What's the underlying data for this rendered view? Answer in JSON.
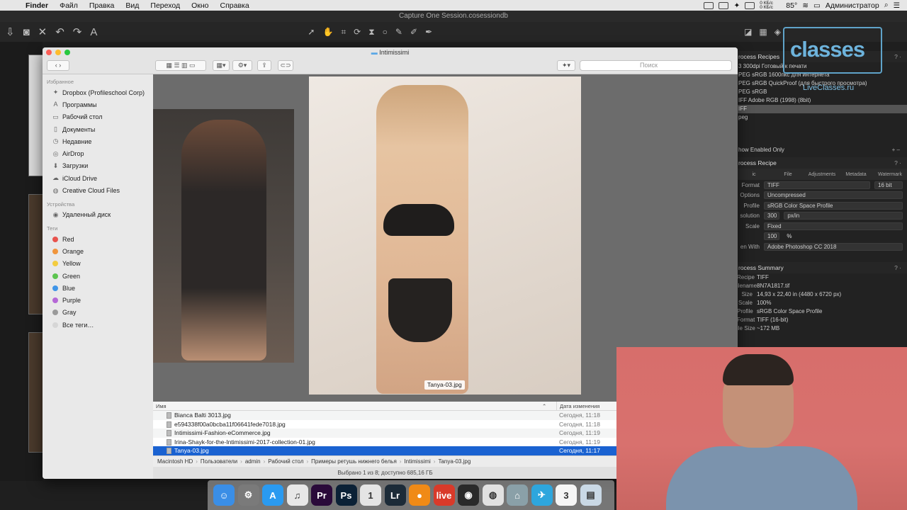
{
  "menubar": {
    "app_name": "Finder",
    "items": [
      "Файл",
      "Правка",
      "Вид",
      "Переход",
      "Окно",
      "Справка"
    ],
    "battery": "85°",
    "net_up": "0 КБ/с",
    "net_down": "0 КБ/с",
    "user": "Администратор"
  },
  "c1": {
    "window_title": "Capture One Session.cosessiondb",
    "recipes_header": "rocess Recipes",
    "recipes": [
      "3 300dpi Готовый к печати",
      "PEG sRGB 1600пкс для интернета",
      "PEG sRGB QuickProof (для быстрого просмотра)",
      "PEG sRGB",
      "IFF Adobe RGB (1998) (8bit)",
      "IFF",
      "peg"
    ],
    "show_enabled": "how Enabled Only",
    "recipe_header": "rocess Recipe",
    "tabs": [
      "ic",
      "File",
      "Adjustments",
      "Metadata",
      "Watermark"
    ],
    "format_label": "Format",
    "format_value": "TIFF",
    "bit_value": "16 bit",
    "options_label": "Options",
    "options_value": "Uncompressed",
    "profile_label": "Profile",
    "profile_value": "sRGB Color Space Profile",
    "resolution_label": "solution",
    "resolution_value": "300",
    "resolution_unit": "px/in",
    "scale_label": "Scale",
    "scale_value": "Fixed",
    "scale_pct": "100",
    "pct_sign": "%",
    "open_with_label": "en With",
    "open_with_value": "Adobe Photoshop CC 2018",
    "summary_header": "rocess Summary",
    "summary": [
      {
        "label": "Recipe",
        "value": "TIFF"
      },
      {
        "label": "ilename",
        "value": "8N7A1817.tif"
      },
      {
        "label": "Size",
        "value": "14,93 x 22,40 in (4480 x 6720 px)"
      },
      {
        "label": "Scale",
        "value": "100%"
      },
      {
        "label": "Profile",
        "value": "sRGB Color Space Profile"
      },
      {
        "label": "Format",
        "value": "TIFF (16-bit)"
      },
      {
        "label": "ile Size",
        "value": "~172 MB"
      }
    ]
  },
  "logo": {
    "big": "classes",
    "small": "LiveClasses.ru"
  },
  "finder": {
    "title": "Intimissimi",
    "search_placeholder": "Поиск",
    "favorites_header": "Избранное",
    "favorites": [
      {
        "icon": "dropbox-icon",
        "label": "Dropbox (Profileschool Corp)"
      },
      {
        "icon": "applications-icon",
        "label": "Программы"
      },
      {
        "icon": "desktop-icon",
        "label": "Рабочий стол"
      },
      {
        "icon": "documents-icon",
        "label": "Документы"
      },
      {
        "icon": "recents-icon",
        "label": "Недавние"
      },
      {
        "icon": "airdrop-icon",
        "label": "AirDrop"
      },
      {
        "icon": "downloads-icon",
        "label": "Загрузки"
      },
      {
        "icon": "icloud-icon",
        "label": "iCloud Drive"
      },
      {
        "icon": "creative-cloud-icon",
        "label": "Creative Cloud Files"
      }
    ],
    "devices_header": "Устройства",
    "devices": [
      {
        "icon": "remote-disk-icon",
        "label": "Удаленный диск"
      }
    ],
    "tags_header": "Теги",
    "tags": [
      {
        "label": "Red",
        "color": "#e8534d"
      },
      {
        "label": "Orange",
        "color": "#f0953c"
      },
      {
        "label": "Yellow",
        "color": "#f3cc3f"
      },
      {
        "label": "Green",
        "color": "#5cc44f"
      },
      {
        "label": "Blue",
        "color": "#3f95e8"
      },
      {
        "label": "Purple",
        "color": "#b568d6"
      },
      {
        "label": "Gray",
        "color": "#9a9a9a"
      },
      {
        "label": "Все теги…",
        "color": "#d6d6d6"
      }
    ],
    "preview_label": "Tanya-03.jpg",
    "columns": {
      "name": "Имя",
      "date": "Дата изменения"
    },
    "files": [
      {
        "name": "Bianca Balti 3013.jpg",
        "date": "Сегодня, 11:18"
      },
      {
        "name": "e594338f00a0bcba11f06641fede7018.jpg",
        "date": "Сегодня, 11:18"
      },
      {
        "name": "Intimissimi-Fashion-eCommerce.jpg",
        "date": "Сегодня, 11:19"
      },
      {
        "name": "Irina-Shayk-for-the-Intimissimi-2017-collection-01.jpg",
        "date": "Сегодня, 11:19"
      },
      {
        "name": "Tanya-03.jpg",
        "date": "Сегодня, 11:17"
      }
    ],
    "path": [
      "Macintosh HD",
      "Пользователи",
      "admin",
      "Рабочий стол",
      "Примеры ретушь нижнего белья",
      "Intimissimi",
      "Tanya-03.jpg"
    ],
    "status": "Выбрано 1 из 8; доступно 685,16 ГБ"
  },
  "dock": [
    {
      "name": "finder",
      "glyph": "☺",
      "color": "#3a8ee6"
    },
    {
      "name": "system-preferences",
      "glyph": "⚙",
      "color": "#7a7a7a"
    },
    {
      "name": "app-store",
      "glyph": "A",
      "color": "#2a9af0"
    },
    {
      "name": "itunes",
      "glyph": "♫",
      "color": "#e7e7e7"
    },
    {
      "name": "premiere",
      "glyph": "Pr",
      "color": "#2a0a3a"
    },
    {
      "name": "photoshop",
      "glyph": "Ps",
      "color": "#0b2136"
    },
    {
      "name": "capture-one",
      "glyph": "1",
      "color": "#e4e4e4"
    },
    {
      "name": "lightroom",
      "glyph": "Lr",
      "color": "#1c2b38"
    },
    {
      "name": "app-orange",
      "glyph": "●",
      "color": "#f08a16"
    },
    {
      "name": "live",
      "glyph": "live",
      "color": "#d93a2a"
    },
    {
      "name": "camera",
      "glyph": "◉",
      "color": "#2a2a2a"
    },
    {
      "name": "chrome",
      "glyph": "◍",
      "color": "#e1e1e1"
    },
    {
      "name": "app-teal",
      "glyph": "⌂",
      "color": "#8aa0a8"
    },
    {
      "name": "telegram",
      "glyph": "✈",
      "color": "#2ea6dd"
    },
    {
      "name": "calendar",
      "glyph": "3",
      "color": "#f5f5f5"
    },
    {
      "name": "preview",
      "glyph": "▤",
      "color": "#c9d8e5"
    }
  ]
}
